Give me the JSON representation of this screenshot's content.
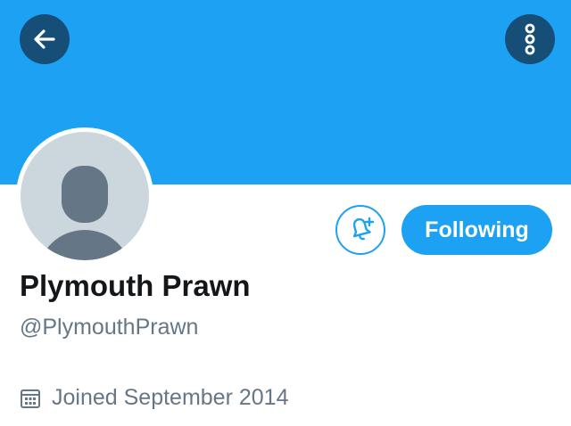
{
  "header": {
    "back_icon": "arrow-left-icon",
    "more_icon": "more-vertical-icon",
    "banner_color": "#1da1f2"
  },
  "profile": {
    "display_name": "Plymouth Prawn",
    "handle": "@PlymouthPrawn",
    "joined": "Joined September 2014",
    "avatar_icon": "default-avatar-icon"
  },
  "actions": {
    "notifications_icon": "bell-plus-icon",
    "following_label": "Following",
    "accent_color": "#1da1f2"
  },
  "meta_icons": {
    "joined_icon": "calendar-icon"
  }
}
